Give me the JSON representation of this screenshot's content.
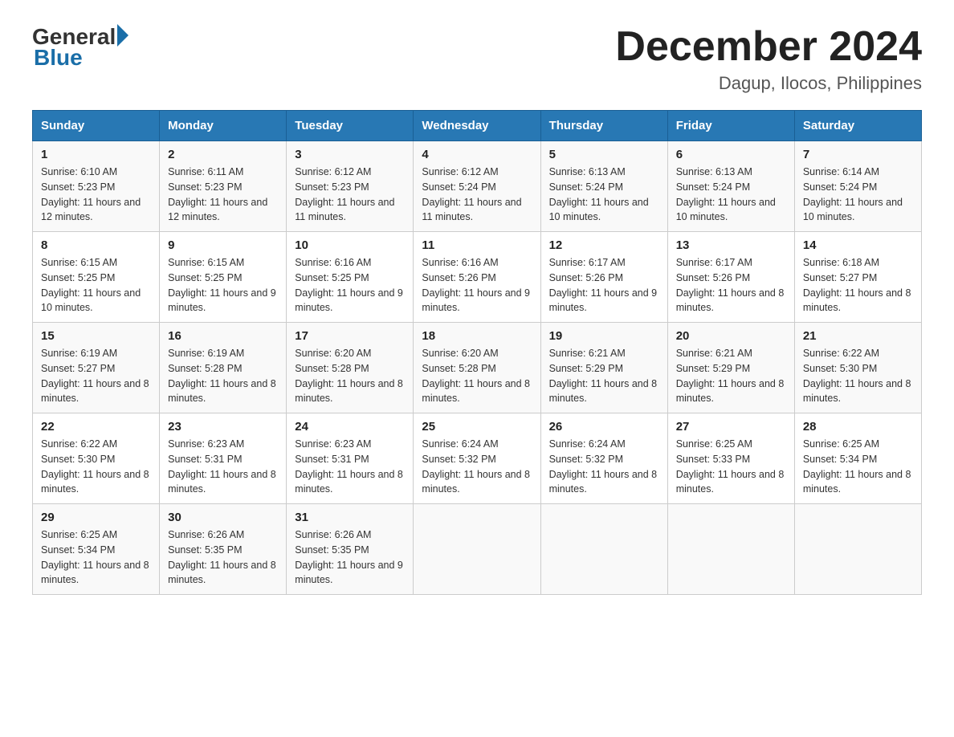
{
  "header": {
    "logo_text": "General",
    "logo_blue": "Blue",
    "title": "December 2024",
    "location": "Dagup, Ilocos, Philippines"
  },
  "days_of_week": [
    "Sunday",
    "Monday",
    "Tuesday",
    "Wednesday",
    "Thursday",
    "Friday",
    "Saturday"
  ],
  "weeks": [
    [
      {
        "day": "1",
        "sunrise": "6:10 AM",
        "sunset": "5:23 PM",
        "daylight": "11 hours and 12 minutes."
      },
      {
        "day": "2",
        "sunrise": "6:11 AM",
        "sunset": "5:23 PM",
        "daylight": "11 hours and 12 minutes."
      },
      {
        "day": "3",
        "sunrise": "6:12 AM",
        "sunset": "5:23 PM",
        "daylight": "11 hours and 11 minutes."
      },
      {
        "day": "4",
        "sunrise": "6:12 AM",
        "sunset": "5:24 PM",
        "daylight": "11 hours and 11 minutes."
      },
      {
        "day": "5",
        "sunrise": "6:13 AM",
        "sunset": "5:24 PM",
        "daylight": "11 hours and 10 minutes."
      },
      {
        "day": "6",
        "sunrise": "6:13 AM",
        "sunset": "5:24 PM",
        "daylight": "11 hours and 10 minutes."
      },
      {
        "day": "7",
        "sunrise": "6:14 AM",
        "sunset": "5:24 PM",
        "daylight": "11 hours and 10 minutes."
      }
    ],
    [
      {
        "day": "8",
        "sunrise": "6:15 AM",
        "sunset": "5:25 PM",
        "daylight": "11 hours and 10 minutes."
      },
      {
        "day": "9",
        "sunrise": "6:15 AM",
        "sunset": "5:25 PM",
        "daylight": "11 hours and 9 minutes."
      },
      {
        "day": "10",
        "sunrise": "6:16 AM",
        "sunset": "5:25 PM",
        "daylight": "11 hours and 9 minutes."
      },
      {
        "day": "11",
        "sunrise": "6:16 AM",
        "sunset": "5:26 PM",
        "daylight": "11 hours and 9 minutes."
      },
      {
        "day": "12",
        "sunrise": "6:17 AM",
        "sunset": "5:26 PM",
        "daylight": "11 hours and 9 minutes."
      },
      {
        "day": "13",
        "sunrise": "6:17 AM",
        "sunset": "5:26 PM",
        "daylight": "11 hours and 8 minutes."
      },
      {
        "day": "14",
        "sunrise": "6:18 AM",
        "sunset": "5:27 PM",
        "daylight": "11 hours and 8 minutes."
      }
    ],
    [
      {
        "day": "15",
        "sunrise": "6:19 AM",
        "sunset": "5:27 PM",
        "daylight": "11 hours and 8 minutes."
      },
      {
        "day": "16",
        "sunrise": "6:19 AM",
        "sunset": "5:28 PM",
        "daylight": "11 hours and 8 minutes."
      },
      {
        "day": "17",
        "sunrise": "6:20 AM",
        "sunset": "5:28 PM",
        "daylight": "11 hours and 8 minutes."
      },
      {
        "day": "18",
        "sunrise": "6:20 AM",
        "sunset": "5:28 PM",
        "daylight": "11 hours and 8 minutes."
      },
      {
        "day": "19",
        "sunrise": "6:21 AM",
        "sunset": "5:29 PM",
        "daylight": "11 hours and 8 minutes."
      },
      {
        "day": "20",
        "sunrise": "6:21 AM",
        "sunset": "5:29 PM",
        "daylight": "11 hours and 8 minutes."
      },
      {
        "day": "21",
        "sunrise": "6:22 AM",
        "sunset": "5:30 PM",
        "daylight": "11 hours and 8 minutes."
      }
    ],
    [
      {
        "day": "22",
        "sunrise": "6:22 AM",
        "sunset": "5:30 PM",
        "daylight": "11 hours and 8 minutes."
      },
      {
        "day": "23",
        "sunrise": "6:23 AM",
        "sunset": "5:31 PM",
        "daylight": "11 hours and 8 minutes."
      },
      {
        "day": "24",
        "sunrise": "6:23 AM",
        "sunset": "5:31 PM",
        "daylight": "11 hours and 8 minutes."
      },
      {
        "day": "25",
        "sunrise": "6:24 AM",
        "sunset": "5:32 PM",
        "daylight": "11 hours and 8 minutes."
      },
      {
        "day": "26",
        "sunrise": "6:24 AM",
        "sunset": "5:32 PM",
        "daylight": "11 hours and 8 minutes."
      },
      {
        "day": "27",
        "sunrise": "6:25 AM",
        "sunset": "5:33 PM",
        "daylight": "11 hours and 8 minutes."
      },
      {
        "day": "28",
        "sunrise": "6:25 AM",
        "sunset": "5:34 PM",
        "daylight": "11 hours and 8 minutes."
      }
    ],
    [
      {
        "day": "29",
        "sunrise": "6:25 AM",
        "sunset": "5:34 PM",
        "daylight": "11 hours and 8 minutes."
      },
      {
        "day": "30",
        "sunrise": "6:26 AM",
        "sunset": "5:35 PM",
        "daylight": "11 hours and 8 minutes."
      },
      {
        "day": "31",
        "sunrise": "6:26 AM",
        "sunset": "5:35 PM",
        "daylight": "11 hours and 9 minutes."
      },
      {
        "day": "",
        "sunrise": "",
        "sunset": "",
        "daylight": ""
      },
      {
        "day": "",
        "sunrise": "",
        "sunset": "",
        "daylight": ""
      },
      {
        "day": "",
        "sunrise": "",
        "sunset": "",
        "daylight": ""
      },
      {
        "day": "",
        "sunrise": "",
        "sunset": "",
        "daylight": ""
      }
    ]
  ]
}
